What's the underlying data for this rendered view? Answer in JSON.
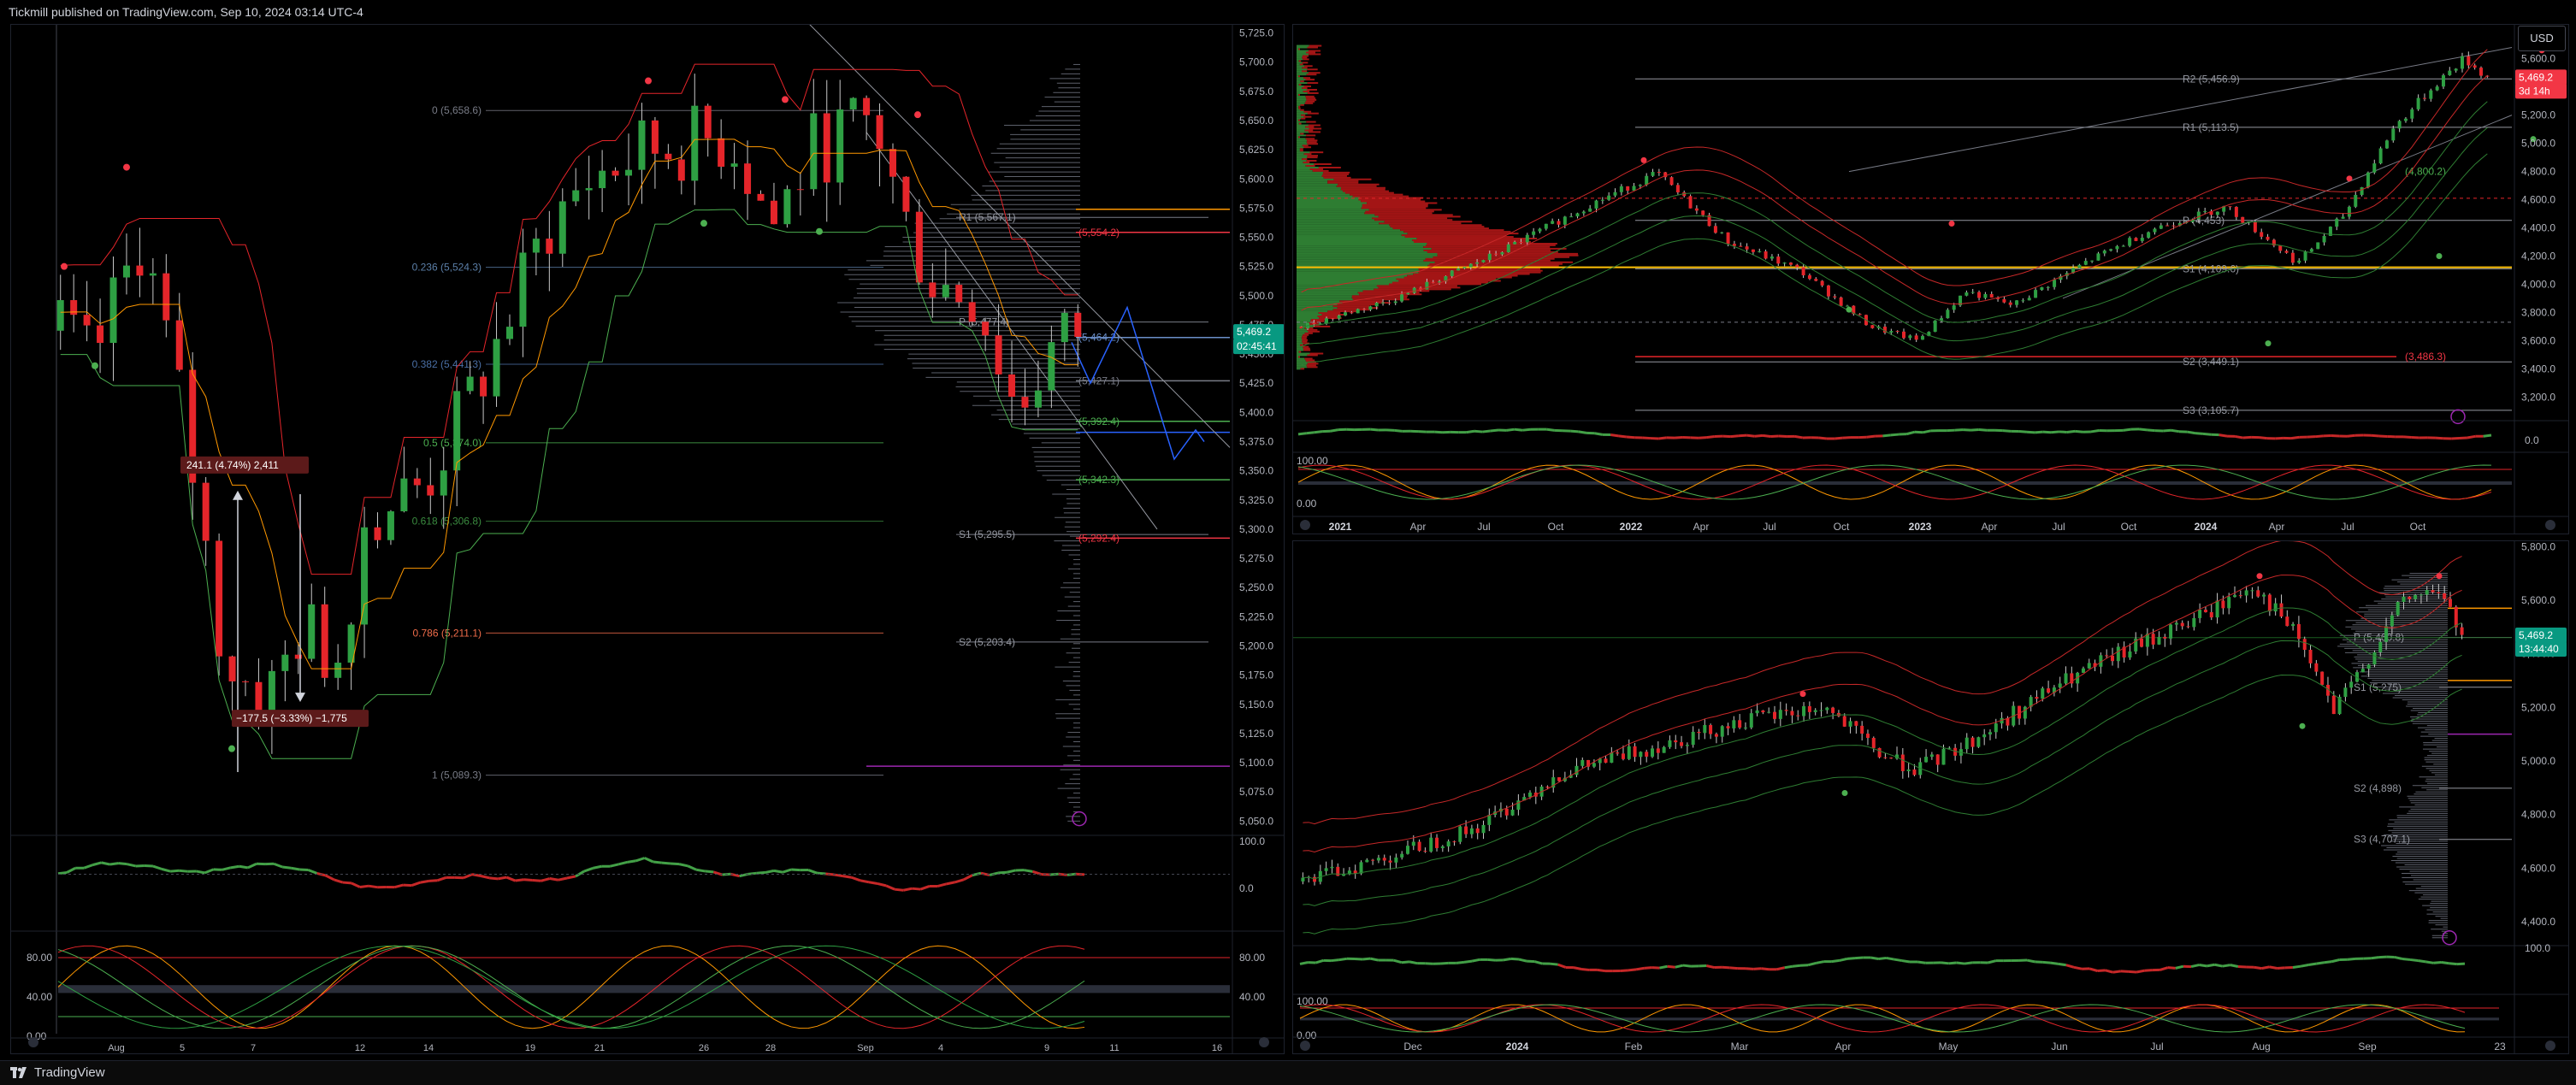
{
  "header": {
    "published_text": "Tickmill published on TradingView.com, Sep 10, 2024 03:14 UTC-4"
  },
  "footer": {
    "brand": "TradingView"
  },
  "currency_button": "USD",
  "chart_data": [
    {
      "type": "candlestick",
      "pane": "left-daily",
      "price_axis_ticks": [
        "5,725.0",
        "5,700.0",
        "5,675.0",
        "5,650.0",
        "5,625.0",
        "5,600.0",
        "5,575.0",
        "5,550.0",
        "5,525.0",
        "5,500.0",
        "5,475.0",
        "5,450.0",
        "5,425.0",
        "5,400.0",
        "5,375.0",
        "5,350.0",
        "5,325.0",
        "5,300.0",
        "5,275.0",
        "5,250.0",
        "5,225.0",
        "5,200.0",
        "5,175.0",
        "5,150.0",
        "5,125.0",
        "5,100.0",
        "5,075.0",
        "5,050.0"
      ],
      "time_axis_ticks": [
        "Aug",
        "5",
        "7",
        "12",
        "14",
        "19",
        "21",
        "26",
        "28",
        "Sep",
        "4",
        "9",
        "11",
        "16"
      ],
      "fib_levels": [
        {
          "label": "0 (5,658.6)",
          "value": 5658.6,
          "color": "#787b86"
        },
        {
          "label": "0.236 (5,524.3)",
          "value": 5524.3,
          "color": "#5b7fa8"
        },
        {
          "label": "0.382 (5,441.3)",
          "value": 5441.3,
          "color": "#4a6fa5"
        },
        {
          "label": "0.5 (5,374.0)",
          "value": 5374.0,
          "color": "#4caf50"
        },
        {
          "label": "0.618 (5,306.8)",
          "value": 5306.8,
          "color": "#3a8a3f"
        },
        {
          "label": "0.786 (5,211.1)",
          "value": 5211.1,
          "color": "#ef6c4a"
        },
        {
          "label": "1 (5,089.3)",
          "value": 5089.3,
          "color": "#787b86"
        }
      ],
      "pivot_levels": [
        {
          "label": "R1 (5,567.1)",
          "value": 5567.1
        },
        {
          "label": "P (5,477.4)",
          "value": 5477.4
        },
        {
          "label": "S1 (5,295.5)",
          "value": 5295.5
        },
        {
          "label": "S2 (5,203.4)",
          "value": 5203.4
        }
      ],
      "level_labels": [
        {
          "label": "(5,554.2)",
          "value": 5554.2,
          "color": "#f23645"
        },
        {
          "label": "(5,464.2)",
          "value": 5464.2,
          "color": "#6b8fc9"
        },
        {
          "label": "(5,427.1)",
          "value": 5427.1,
          "color": "#787b86"
        },
        {
          "label": "(5,392.4)",
          "value": 5392.4,
          "color": "#4caf50"
        },
        {
          "label": "(5,342.3)",
          "value": 5342.3,
          "color": "#4caf50"
        },
        {
          "label": "(5,292.4)",
          "value": 5292.4,
          "color": "#f23645"
        }
      ],
      "measure_up": "241.1 (4.74%) 2,411",
      "measure_down": "−177.5 (−3.33%) −1,775",
      "last_price": "5,469.2",
      "countdown": "02:45:41",
      "rsi_ticks": [
        "100.0",
        "0.0"
      ],
      "stoch_ticks": [
        "80.00",
        "40.00",
        "0.00"
      ],
      "stoch_right_ticks": [
        "80.00",
        "40.00"
      ]
    },
    {
      "type": "candlestick",
      "pane": "top-right-weekly",
      "price_axis_ticks": [
        "5,600.0",
        "5,400.0",
        "5,200.0",
        "5,000.0",
        "4,800.0",
        "4,600.0",
        "4,400.0",
        "4,200.0",
        "4,000.0",
        "3,800.0",
        "3,600.0",
        "3,400.0",
        "3,200.0"
      ],
      "time_axis_ticks": [
        "2021",
        "Apr",
        "Jul",
        "Oct",
        "2022",
        "Apr",
        "Jul",
        "Oct",
        "2023",
        "Apr",
        "Jul",
        "Oct",
        "2024",
        "Apr",
        "Jul",
        "Oct"
      ],
      "pivot_levels": [
        {
          "label": "R2 (5,456.9)",
          "value": 5456.9
        },
        {
          "label": "R1 (5,113.5)",
          "value": 5113.5
        },
        {
          "label": "P (4,453)",
          "value": 4453
        },
        {
          "label": "S1 (4,109.6)",
          "value": 4109.6
        },
        {
          "label": "S2 (3,449.1)",
          "value": 3449.1
        },
        {
          "label": "S3 (3,105.7)",
          "value": 3105.7
        }
      ],
      "level_labels": [
        {
          "label": "(3,486.3)",
          "value": 3486.3,
          "color": "#f23645"
        },
        {
          "label": "(4,800.2)",
          "value": 4800.2,
          "color": "#4caf50"
        }
      ],
      "last_price": "5,469.2",
      "countdown": "3d 14h",
      "rsi_ticks": [
        "0.0"
      ],
      "stoch_ticks": [
        "100.00",
        "0.00"
      ]
    },
    {
      "type": "candlestick",
      "pane": "bottom-right-daily",
      "price_axis_ticks": [
        "5,800.0",
        "5,600.0",
        "5,400.0",
        "5,200.0",
        "5,000.0",
        "4,800.0",
        "4,600.0",
        "4,400.0"
      ],
      "time_axis_ticks": [
        "Dec",
        "2024",
        "Feb",
        "Mar",
        "Apr",
        "May",
        "Jun",
        "Jul",
        "Aug",
        "Sep",
        "23"
      ],
      "pivot_levels": [
        {
          "label": "P (5,460.8)",
          "value": 5460.8
        },
        {
          "label": "S1 (5,275)",
          "value": 5275
        },
        {
          "label": "S2 (4,898)",
          "value": 4898
        },
        {
          "label": "S3 (4,707.1)",
          "value": 4707.1
        }
      ],
      "last_price": "5,469.2",
      "countdown": "13:44:40",
      "rsi_ticks": [
        "100.0"
      ],
      "stoch_ticks": [
        "100.00",
        "0.00"
      ]
    }
  ]
}
